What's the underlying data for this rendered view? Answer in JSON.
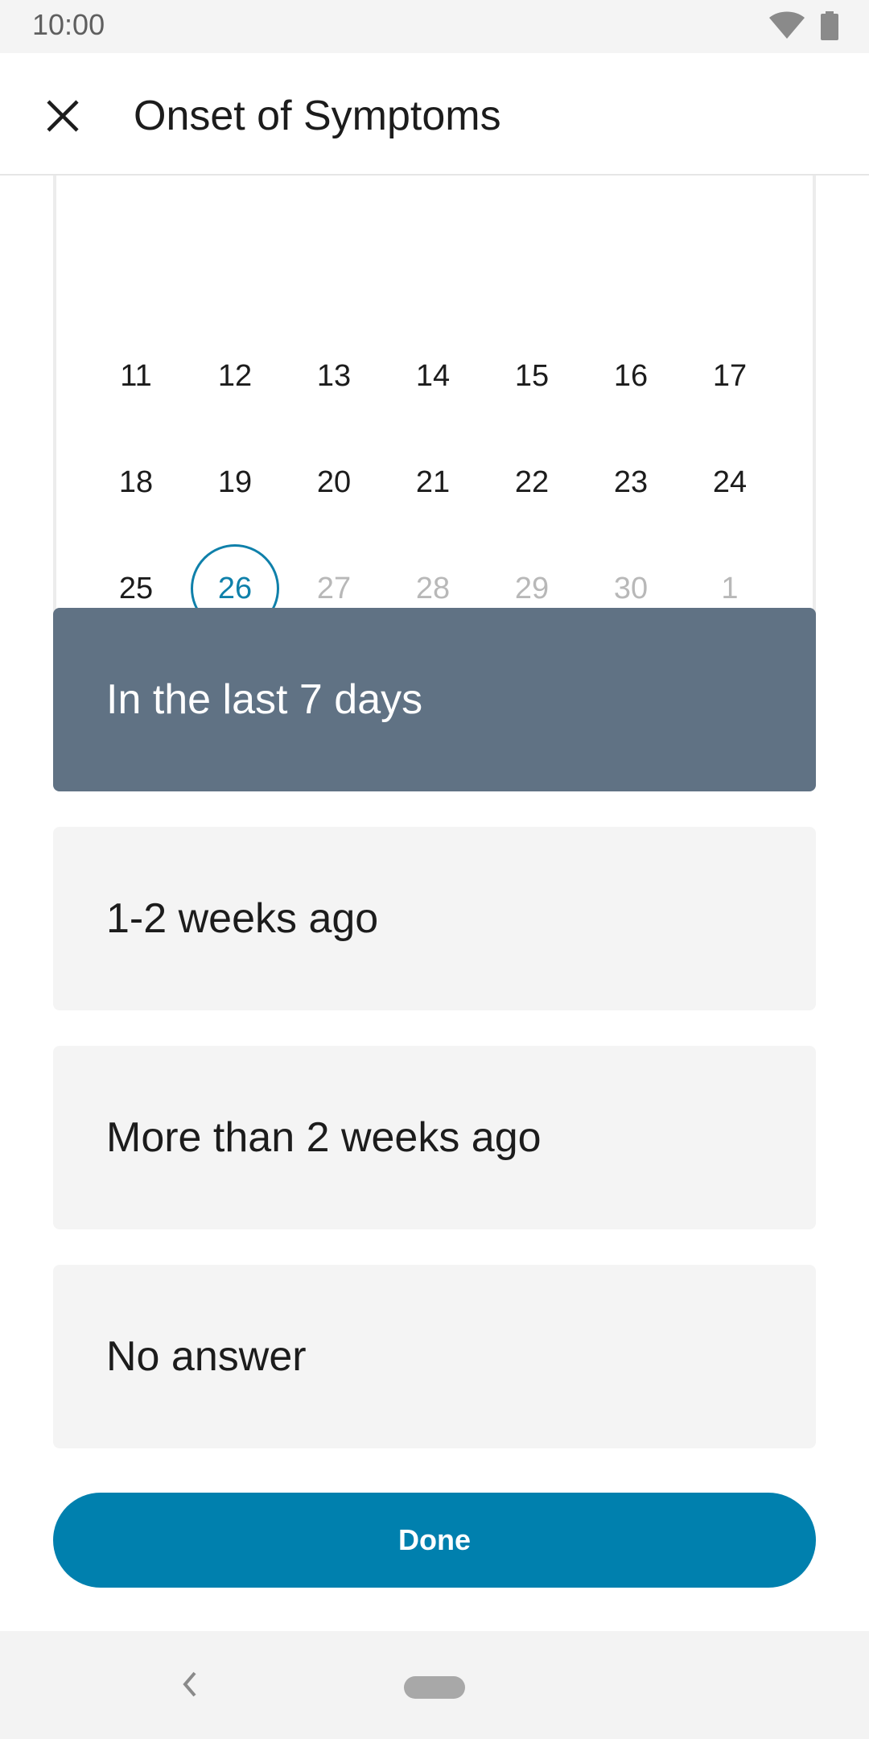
{
  "status_bar": {
    "time": "10:00",
    "icons": [
      "wifi-icon",
      "battery-icon"
    ]
  },
  "app_bar": {
    "title": "Onset of Symptoms",
    "close_icon": "close-icon"
  },
  "calendar": {
    "weeks": [
      [
        {
          "label": "11",
          "state": "normal"
        },
        {
          "label": "12",
          "state": "normal"
        },
        {
          "label": "13",
          "state": "normal"
        },
        {
          "label": "14",
          "state": "normal"
        },
        {
          "label": "15",
          "state": "normal"
        },
        {
          "label": "16",
          "state": "normal"
        },
        {
          "label": "17",
          "state": "normal"
        }
      ],
      [
        {
          "label": "18",
          "state": "normal"
        },
        {
          "label": "19",
          "state": "normal"
        },
        {
          "label": "20",
          "state": "normal"
        },
        {
          "label": "21",
          "state": "normal"
        },
        {
          "label": "22",
          "state": "normal"
        },
        {
          "label": "23",
          "state": "normal"
        },
        {
          "label": "24",
          "state": "normal"
        }
      ],
      [
        {
          "label": "25",
          "state": "normal"
        },
        {
          "label": "26",
          "state": "selected"
        },
        {
          "label": "27",
          "state": "disabled"
        },
        {
          "label": "28",
          "state": "disabled"
        },
        {
          "label": "29",
          "state": "disabled"
        },
        {
          "label": "30",
          "state": "disabled"
        },
        {
          "label": "1",
          "state": "disabled"
        }
      ]
    ]
  },
  "options": [
    {
      "label": "In the last 7 days",
      "selected": true
    },
    {
      "label": "1-2 weeks ago",
      "selected": false
    },
    {
      "label": "More than 2 weeks ago",
      "selected": false
    },
    {
      "label": "No answer",
      "selected": false
    }
  ],
  "done_label": "Done",
  "colors": {
    "accent": "#0080ae",
    "selected_option": "#607284",
    "option_background": "#f4f4f4",
    "disabled_day": "#b8b8b8"
  }
}
